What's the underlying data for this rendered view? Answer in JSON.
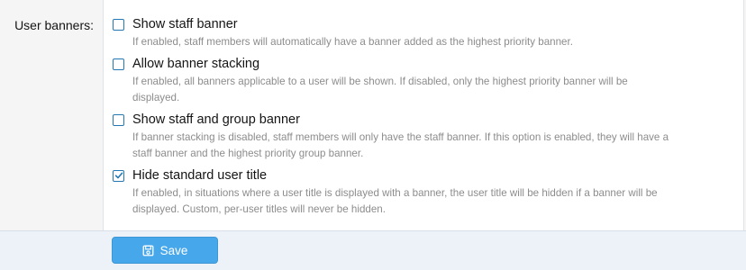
{
  "field": {
    "label": "User banners:"
  },
  "options": [
    {
      "title": "Show staff banner",
      "desc_lines": [
        "If enabled, staff members will automatically have a banner added as the highest priority banner."
      ],
      "checked": false
    },
    {
      "title": "Allow banner stacking",
      "desc_lines": [
        "If enabled, all banners applicable to a user will be shown. If disabled, only the highest priority banner will be",
        "displayed."
      ],
      "checked": false
    },
    {
      "title": "Show staff and group banner",
      "desc_lines": [
        "If banner stacking is disabled, staff members will only have the staff banner. If this option is enabled, they will have a",
        "staff banner and the highest priority group banner."
      ],
      "checked": false
    },
    {
      "title": "Hide standard user title",
      "desc_lines": [
        "If enabled, in situations where a user title is displayed with a banner, the user title will be hidden if a banner will be",
        "displayed. Custom, per-user titles will never be hidden."
      ],
      "checked": true
    }
  ],
  "footer": {
    "save_label": "Save",
    "save_icon": "save-icon"
  },
  "colors": {
    "accent": "#2577b1",
    "button": "#47a7eb",
    "footer_bg": "#edf2f8",
    "label_bg": "#f5f5f5",
    "hint_text": "#8c8c8c"
  }
}
